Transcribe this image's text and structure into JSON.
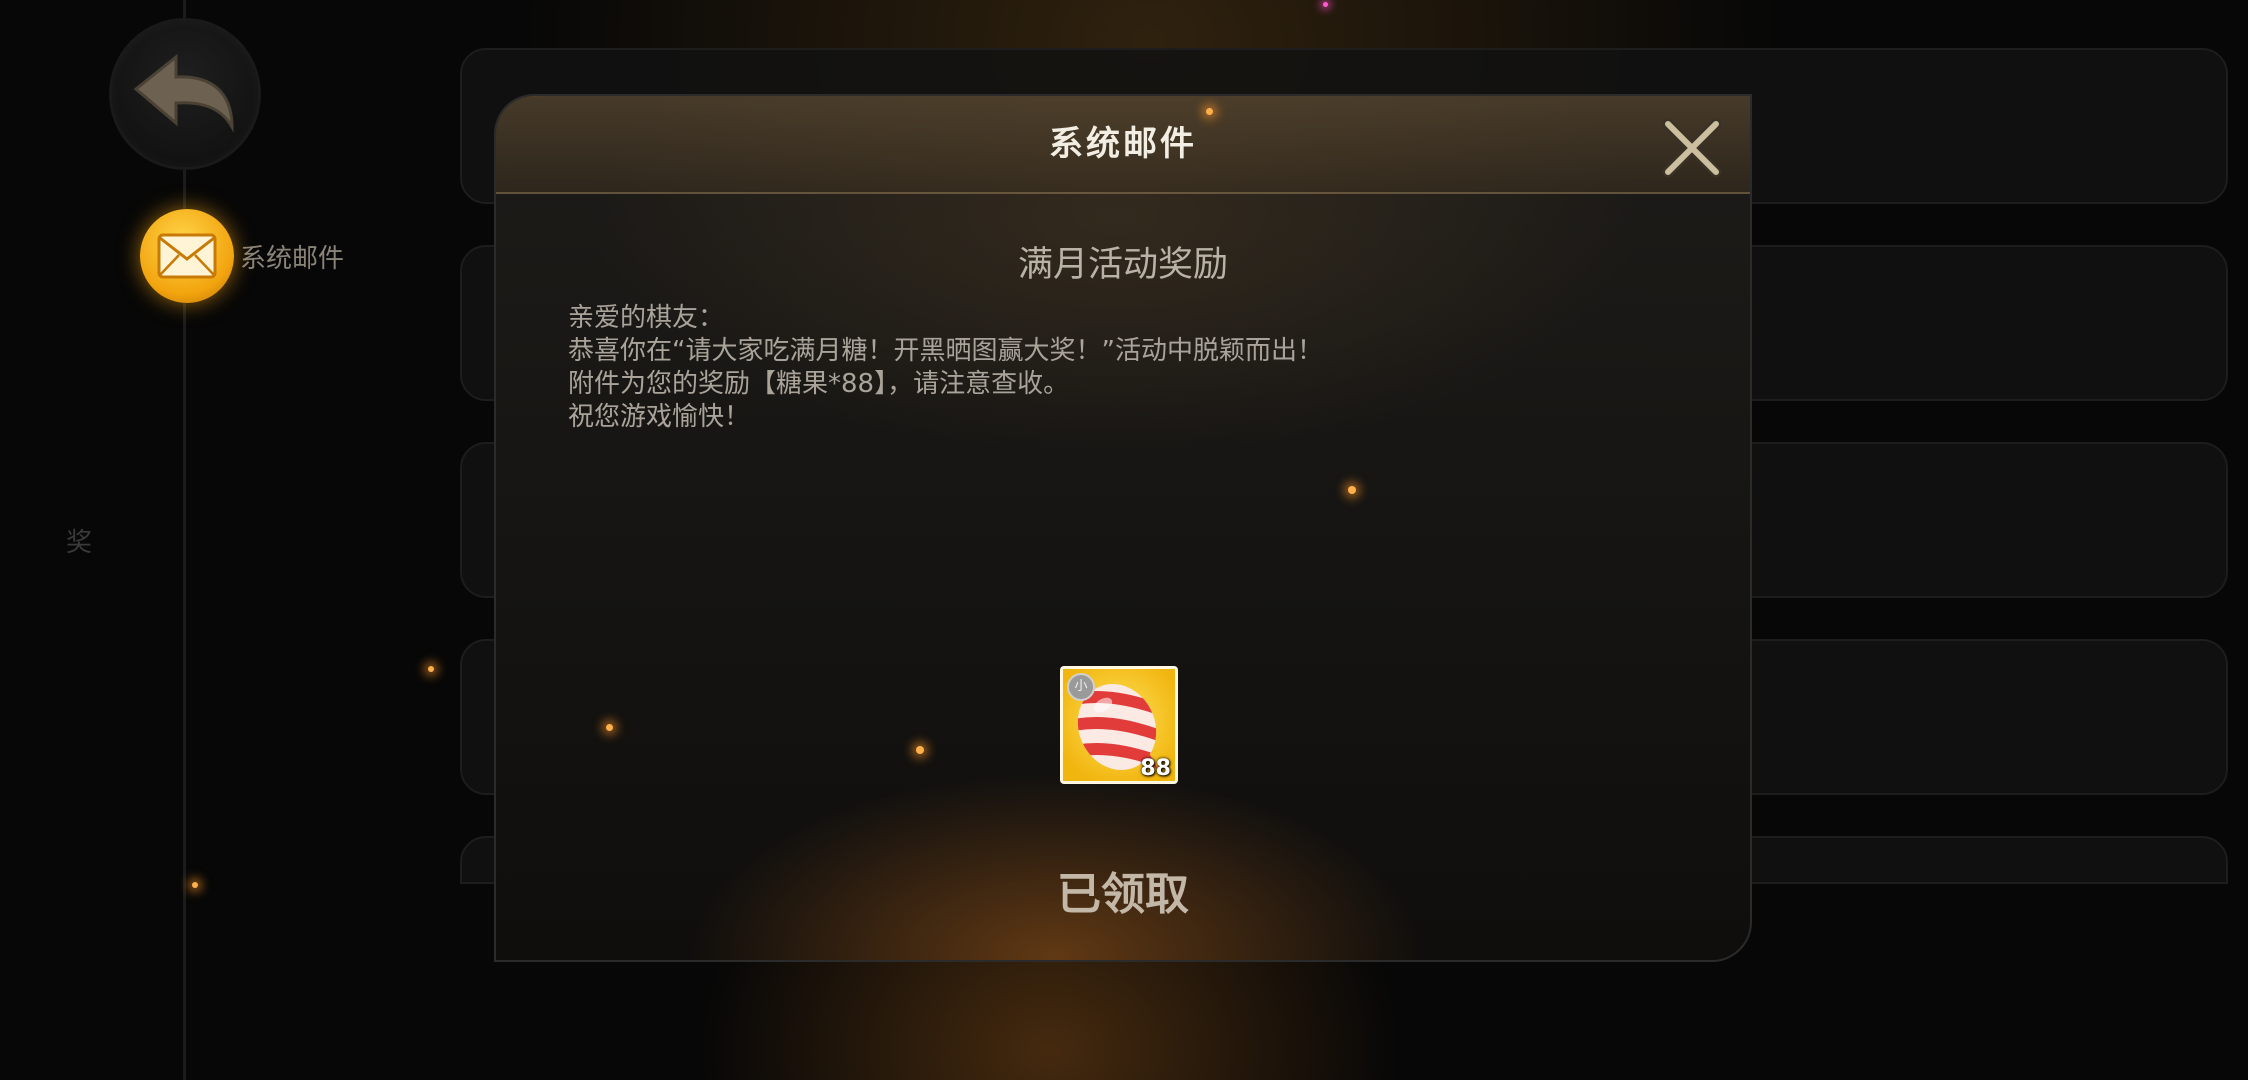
{
  "sidebar": {
    "tab_label": "系统邮件",
    "rail_mark": "奖"
  },
  "modal": {
    "title": "系统邮件",
    "subject": "满月活动奖励",
    "body_lines": [
      "亲爱的棋友：",
      "恭喜你在“请大家吃满月糖！开黑晒图赢大奖！”活动中脱颖而出！",
      "附件为您的奖励【糖果*88】，请注意查收。",
      "祝您游戏愉快！"
    ],
    "reward": {
      "count": "88",
      "badge": "小",
      "icon": "candy-icon"
    },
    "status_label": "已领取"
  },
  "colors": {
    "accent_gold": "#f2a40e",
    "title_text": "#f3eee4",
    "body_text": "#a9a39a"
  }
}
